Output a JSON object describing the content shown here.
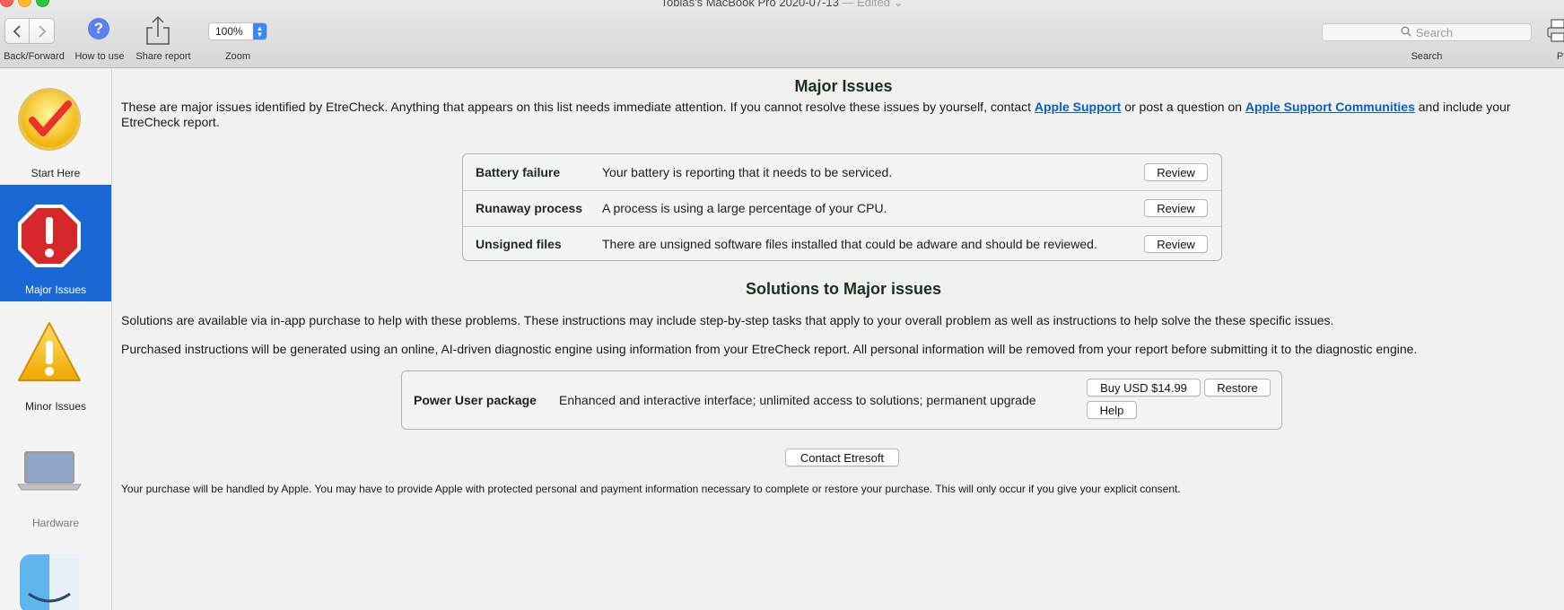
{
  "window": {
    "title": "Tobias's MacBook Pro 2020-07-13",
    "edited": "— Edited ⌄"
  },
  "toolbar": {
    "back_forward_label": "Back/Forward",
    "how_to_use_label": "How to use",
    "share_label": "Share report",
    "zoom_label": "Zoom",
    "zoom_value": "100%",
    "search_placeholder": "Search",
    "search_label": "Search",
    "print_label": "Print"
  },
  "sidebar": {
    "items": [
      {
        "label": "Start Here",
        "icon": "checkmark-badge-icon"
      },
      {
        "label": "Major Issues",
        "icon": "stop-sign-icon",
        "selected": true
      },
      {
        "label": "Minor Issues",
        "icon": "warning-triangle-icon"
      },
      {
        "label": "Hardware",
        "icon": "laptop-icon"
      },
      {
        "label": "",
        "icon": "finder-icon"
      }
    ]
  },
  "main": {
    "title": "Major Issues",
    "intro_text": "These are major issues identified by EtreCheck. Anything that appears on this list needs immediate attention. If you cannot resolve these issues by yourself, contact ",
    "apple_support_link": "Apple Support",
    "intro_mid": " or post a question on ",
    "communities_link": "Apple Support Communities",
    "intro_end": " and include your EtreCheck report.",
    "issues": [
      {
        "name": "Battery failure",
        "description": "Your battery is reporting that it needs to be serviced.",
        "button": "Review"
      },
      {
        "name": "Runaway process",
        "description": "A process is using a large percentage of your CPU.",
        "button": "Review"
      },
      {
        "name": "Unsigned files",
        "description": "There are unsigned software files installed that could be adware and should be reviewed.",
        "button": "Review"
      }
    ],
    "solutions_title": "Solutions to Major issues",
    "solutions_text1": "Solutions are available via in-app purchase to help with these problems. These instructions may include step-by-step tasks that apply to your overall problem as well as instructions to help solve the these specific issues.",
    "solutions_text2": "Purchased instructions will be generated using an online, AI-driven diagnostic engine using information from your EtreCheck report. All personal information will be removed from your report before submitting it to the diagnostic engine.",
    "package": {
      "name": "Power User package",
      "description": "Enhanced and interactive interface; unlimited access to solutions; permanent upgrade",
      "buy_label": "Buy USD $14.99",
      "restore_label": "Restore",
      "help_label": "Help"
    },
    "contact_label": "Contact Etresoft",
    "footer_text": "Your purchase will be handled by Apple. You may have to provide Apple with protected personal and payment information necessary to complete or restore your purchase. This will only occur if you give your explicit consent."
  },
  "colors": {
    "selection": "#1a68d6",
    "link": "#0a5fc4",
    "heading": "#16321c"
  }
}
